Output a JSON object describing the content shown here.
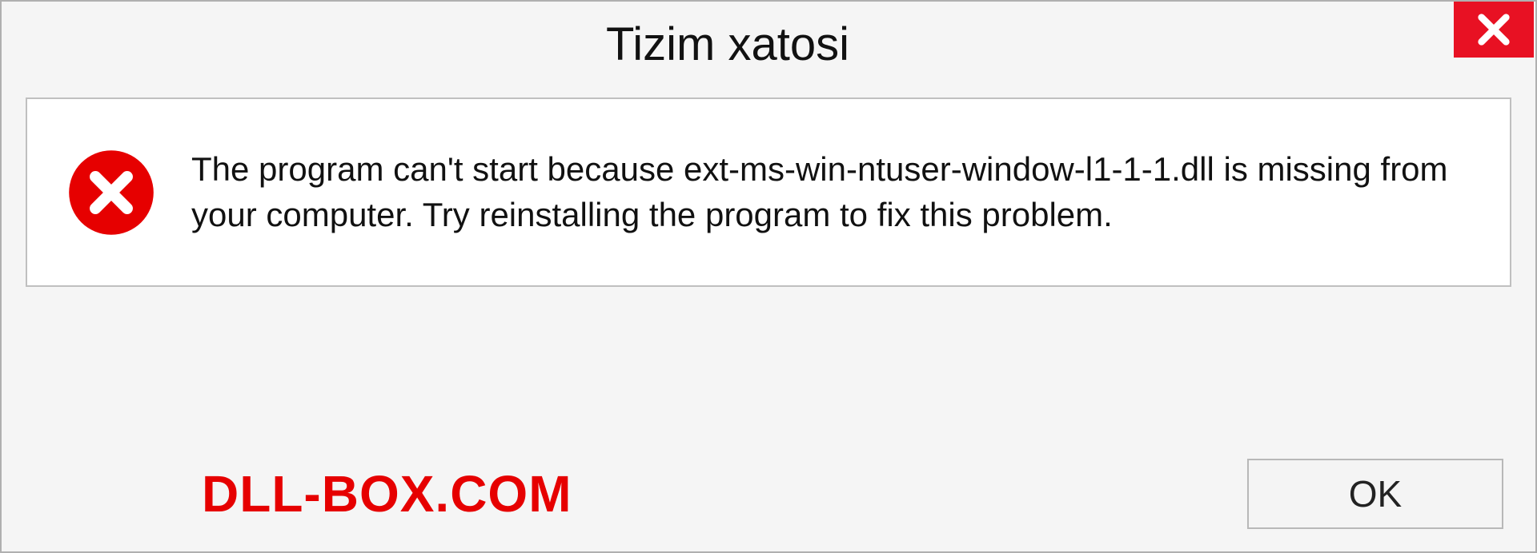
{
  "dialog": {
    "title": "Tizim xatosi",
    "message": "The program can't start because ext-ms-win-ntuser-window-l1-1-1.dll is missing from your computer. Try reinstalling the program to fix this problem.",
    "ok_label": "OK"
  },
  "brand": "DLL-BOX.COM",
  "colors": {
    "close_bg": "#e81123",
    "error_icon": "#e60000",
    "brand": "#e60000"
  }
}
